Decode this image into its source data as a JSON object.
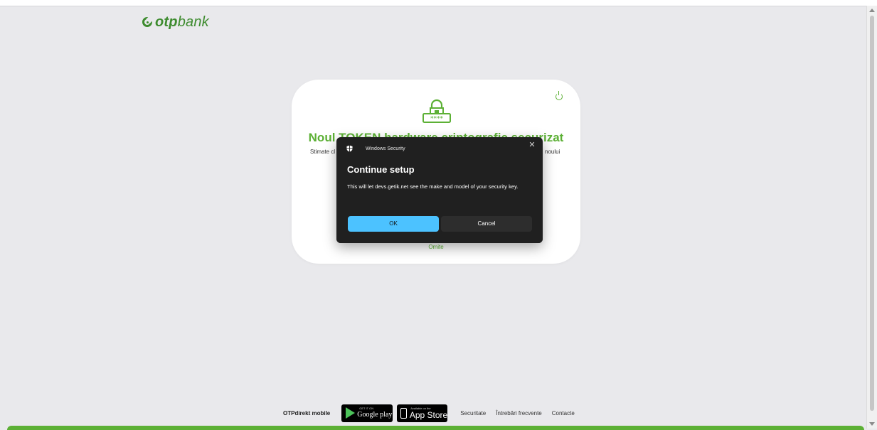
{
  "brand": {
    "logo_bold": "otp",
    "logo_regular": "bank",
    "color": "#3d8b2e",
    "accent": "#5cb035"
  },
  "card": {
    "title": "Noul TOKEN hardware criptografic securizat",
    "text_left": "Stimate cl",
    "text_right": "noului",
    "skip_label": "Omite",
    "icons": [
      "lock-password-icon",
      "power-icon"
    ]
  },
  "dialog": {
    "app_name": "Windows Security",
    "title": "Continue setup",
    "body": "This will let devs.getik.net see the make and model of your security key.",
    "ok_label": "OK",
    "cancel_label": "Cancel",
    "close_glyph": "✕",
    "primary_color": "#4cc2ff",
    "background_color": "#202020"
  },
  "footer": {
    "mobile_label": "OTPdirekt mobile",
    "google_play": {
      "small": "GET IT ON",
      "big": "Google play"
    },
    "app_store": {
      "small": "Available on the",
      "big": "App Store"
    },
    "links": [
      "Securitate",
      "Întrebări frecvente",
      "Contacte"
    ]
  }
}
